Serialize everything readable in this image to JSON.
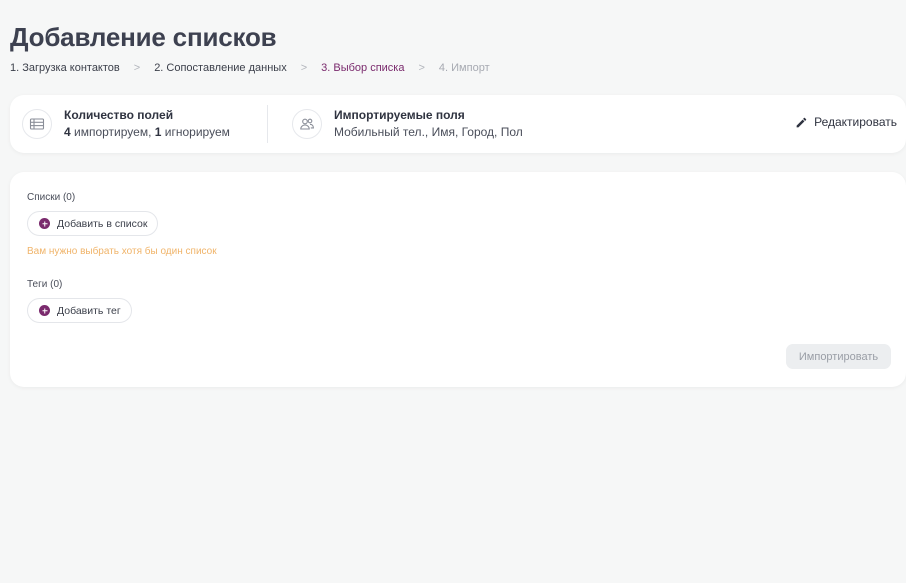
{
  "page": {
    "title": "Добавление списков"
  },
  "steps": [
    {
      "label": "1. Загрузка контактов",
      "state": "done"
    },
    {
      "label": "2. Сопоставление данных",
      "state": "done"
    },
    {
      "label": "3. Выбор списка",
      "state": "active"
    },
    {
      "label": "4. Импорт",
      "state": "future"
    }
  ],
  "steps_separator": ">",
  "summary": {
    "fields": {
      "title": "Количество полей",
      "imported_count": "4",
      "imported_text": " импортируем, ",
      "ignored_count": "1",
      "ignored_text": " игнорируем",
      "icon": "table-icon"
    },
    "imported_fields": {
      "title": "Импортируемые поля",
      "value": "Мобильный тел., Имя, Город, Пол",
      "icon": "users-icon"
    },
    "edit_label": "Редактировать"
  },
  "lists": {
    "label": "Списки (0)",
    "add_label": "Добавить в список",
    "warning": "Вам нужно выбрать хотя бы один список"
  },
  "tags": {
    "label": "Теги (0)",
    "add_label": "Добавить тег"
  },
  "actions": {
    "import_label": "Импортировать",
    "import_disabled": true
  },
  "colors": {
    "accent": "#7a2a6d",
    "warning": "#f0b46a",
    "text": "#3d4150",
    "muted": "#a7aab2"
  }
}
